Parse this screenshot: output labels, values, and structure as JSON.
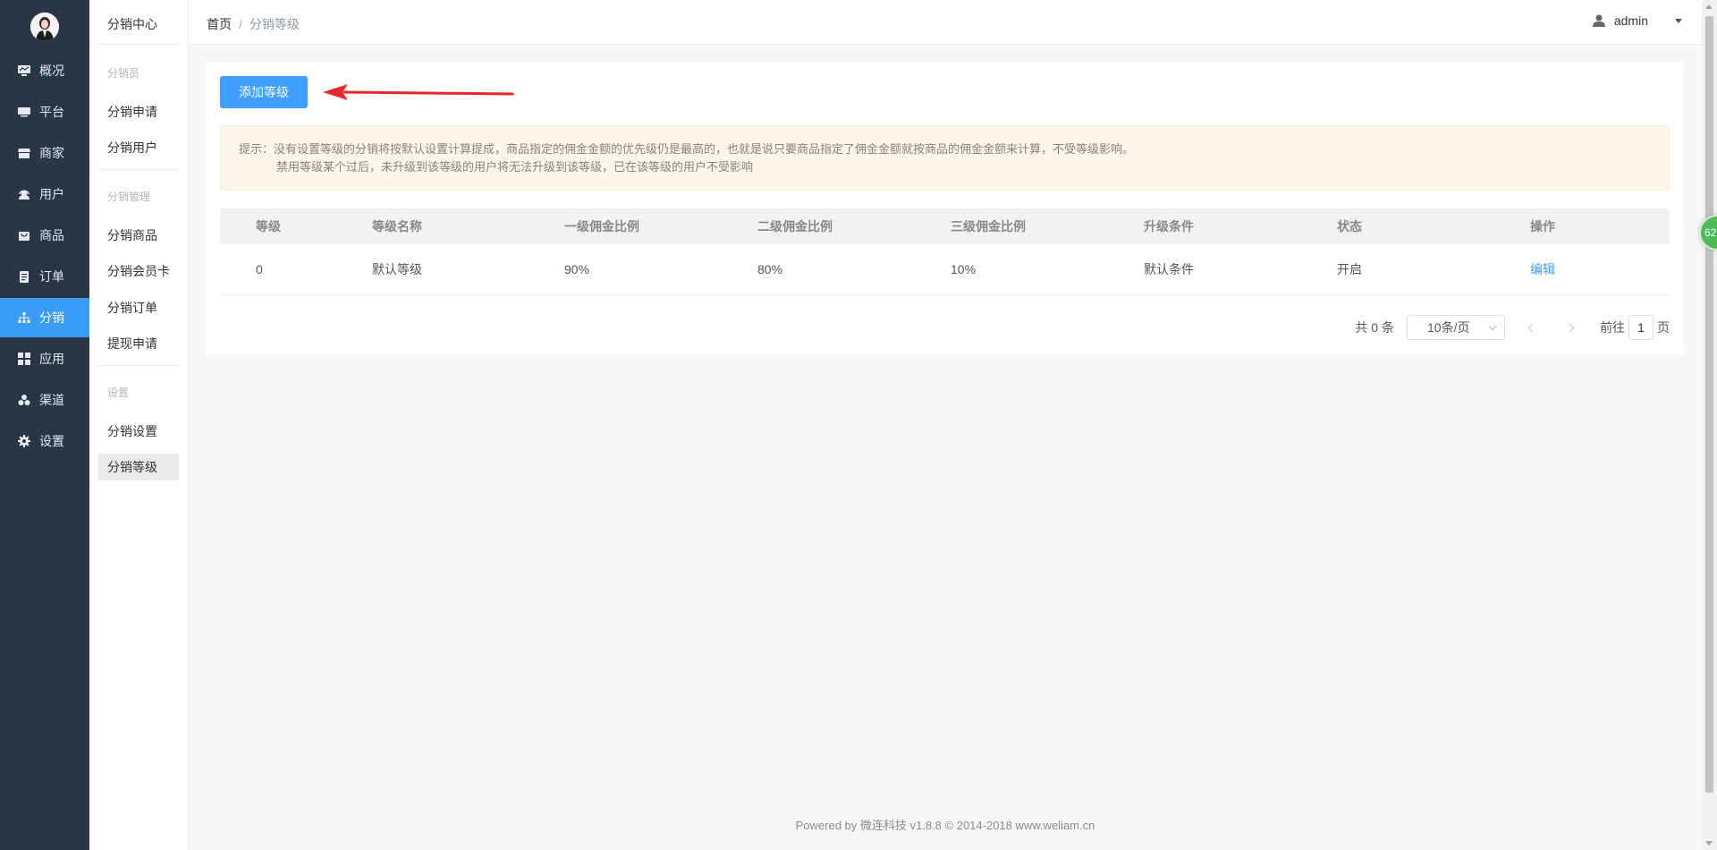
{
  "sidebar": {
    "items": [
      {
        "label": "概况",
        "icon": "monitor-chart-icon"
      },
      {
        "label": "平台",
        "icon": "desktop-icon"
      },
      {
        "label": "商家",
        "icon": "store-icon"
      },
      {
        "label": "用户",
        "icon": "headset-user-icon"
      },
      {
        "label": "商品",
        "icon": "bag-icon"
      },
      {
        "label": "订单",
        "icon": "clipboard-icon"
      },
      {
        "label": "分销",
        "icon": "sitemap-icon"
      },
      {
        "label": "应用",
        "icon": "grid-icon"
      },
      {
        "label": "渠道",
        "icon": "cubes-icon"
      },
      {
        "label": "设置",
        "icon": "gear-icon"
      }
    ],
    "active": "分销"
  },
  "subsidebar": {
    "title": "分销中心",
    "groups": [
      {
        "label": "分销员",
        "items": [
          "分销申请",
          "分销用户"
        ]
      },
      {
        "label": "分销管理",
        "items": [
          "分销商品",
          "分销会员卡",
          "分销订单",
          "提现申请"
        ]
      },
      {
        "label": "设置",
        "items": [
          "分销设置",
          "分销等级"
        ]
      }
    ],
    "active": "分销等级"
  },
  "breadcrumb": {
    "home": "首页",
    "sep": "/",
    "current": "分销等级"
  },
  "user": {
    "name": "admin"
  },
  "toolbar": {
    "add_label": "添加等级"
  },
  "tip": {
    "line1": "提示：没有设置等级的分销将按默认设置计算提成，商品指定的佣金金额的优先级仍是最高的，也就是说只要商品指定了佣金金额就按商品的佣金金额来计算，不受等级影响。",
    "line2": "禁用等级某个过后，未升级到该等级的用户将无法升级到该等级，已在该等级的用户不受影响"
  },
  "table": {
    "headers": [
      "等级",
      "等级名称",
      "一级佣金比例",
      "二级佣金比例",
      "三级佣金比例",
      "升级条件",
      "状态",
      "操作"
    ],
    "rows": [
      {
        "level": "0",
        "name": "默认等级",
        "r1": "90%",
        "r2": "80%",
        "r3": "10%",
        "cond": "默认条件",
        "status": "开启",
        "action": "编辑"
      }
    ]
  },
  "pagination": {
    "total": "共 0 条",
    "page_size": "10条/页",
    "goto_prefix": "前往",
    "page": "1",
    "goto_suffix": "页"
  },
  "footer": {
    "text": "Powered by 微连科技 v1.8.8 © 2014-2018 www.weliam.cn"
  },
  "float_badge": {
    "text": "62"
  },
  "colors": {
    "sidebar_bg": "#283646",
    "accent": "#409eff",
    "active_nav": "#3a9cf6",
    "tip_bg": "#fdf6ec",
    "arrow": "#e8262a"
  }
}
